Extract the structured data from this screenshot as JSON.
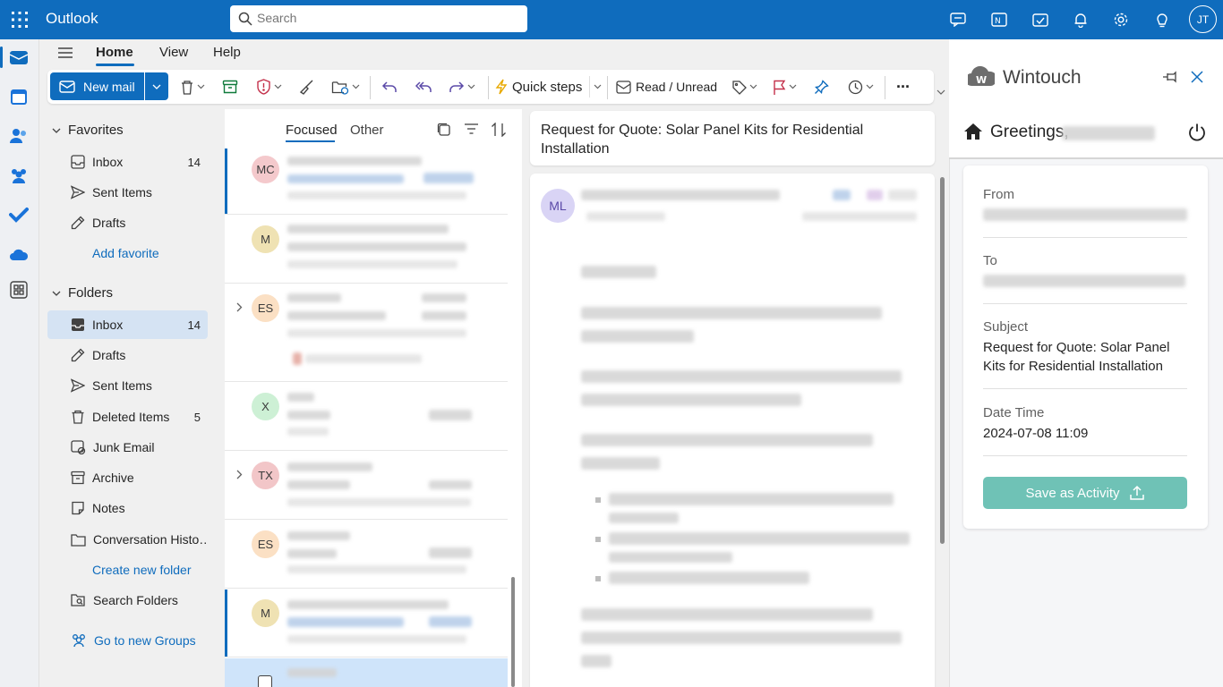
{
  "app": {
    "title": "Outlook",
    "user_initials": "JT"
  },
  "search": {
    "placeholder": "Search"
  },
  "ribbon_tabs": {
    "home": "Home",
    "view": "View",
    "help": "Help"
  },
  "toolbar": {
    "new_mail": "New mail",
    "quick_steps": "Quick steps",
    "read_unread": "Read / Unread",
    "more": "···"
  },
  "favorites": {
    "header": "Favorites",
    "items": [
      {
        "label": "Inbox",
        "count": "14"
      },
      {
        "label": "Sent Items",
        "count": ""
      },
      {
        "label": "Drafts",
        "count": ""
      }
    ],
    "add_favorite": "Add favorite"
  },
  "folders": {
    "header": "Folders",
    "items": [
      {
        "label": "Inbox",
        "count": "14"
      },
      {
        "label": "Drafts",
        "count": ""
      },
      {
        "label": "Sent Items",
        "count": ""
      },
      {
        "label": "Deleted Items",
        "count": "5"
      },
      {
        "label": "Junk Email",
        "count": ""
      },
      {
        "label": "Archive",
        "count": ""
      },
      {
        "label": "Notes",
        "count": ""
      },
      {
        "label": "Conversation Histo…",
        "count": ""
      }
    ],
    "create_new_folder": "Create new folder",
    "search_folders": "Search Folders",
    "go_to_groups": "Go to new Groups"
  },
  "message_list": {
    "tabs": {
      "focused": "Focused",
      "other": "Other"
    },
    "rows": [
      {
        "initials": "MC",
        "avatar_color": "#f4c9cc"
      },
      {
        "initials": "M",
        "avatar_color": "#efe2b3"
      },
      {
        "initials": "ES",
        "avatar_color": "#fbe0c4"
      },
      {
        "initials": "X",
        "avatar_color": "#cdf0d5"
      },
      {
        "initials": "TX",
        "avatar_color": "#f2c6c8"
      },
      {
        "initials": "ES",
        "avatar_color": "#fbe0c4"
      },
      {
        "initials": "M",
        "avatar_color": "#efe2b3"
      }
    ]
  },
  "reading_pane": {
    "subject": "Request for Quote: Solar Panel Kits for Residential Installation",
    "sender_initials": "ML"
  },
  "addin": {
    "title": "Wintouch",
    "greeting": "Greetings,",
    "from_label": "From",
    "to_label": "To",
    "subject_label": "Subject",
    "subject_value": "Request for Quote: Solar Panel Kits for Residential Installation",
    "datetime_label": "Date Time",
    "datetime_value": "2024-07-08 11:09",
    "save_button": "Save as Activity"
  }
}
